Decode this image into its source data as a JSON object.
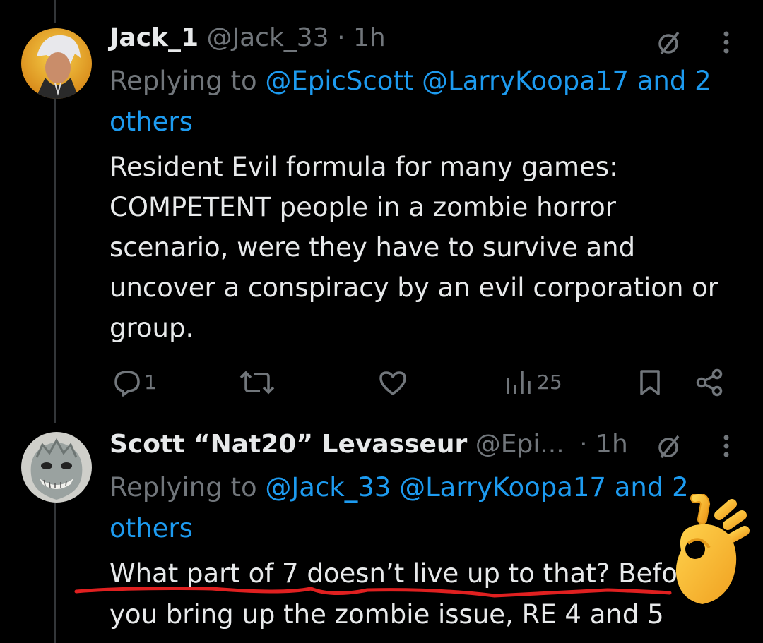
{
  "tweets": [
    {
      "name": "Jack_1",
      "handle": "@Jack_33",
      "time": "· 1h",
      "replying_prefix": "Replying to",
      "replying_handles": "@EpicScott @LarryKoopa17 and 2 others",
      "text": "Resident Evil formula for many games: COMPETENT people in a zombie horror scenario, were they have to survive and uncover a conspiracy by an evil corporation or group.",
      "replies": "1",
      "views": "25"
    },
    {
      "name": "Scott “Nat20” Levasseur",
      "handle": "@Epi...",
      "time": "· 1h",
      "replying_prefix": "Replying to",
      "replying_handles": "@Jack_33 @LarryKoopa17 and 2 others",
      "text_line1": "What part of 7 doesn’t live up to that?  Befo",
      "text_line2": "you bring up the zombie issue, RE 4 and 5"
    }
  ],
  "colors": {
    "link": "#1d9bf0",
    "muted": "#71767b",
    "annotation": "#e02020"
  },
  "icons": [
    "no-grok-icon",
    "more-icon",
    "reply-icon",
    "retweet-icon",
    "like-icon",
    "views-icon",
    "bookmark-icon",
    "share-icon",
    "ok-hand-emoji"
  ]
}
